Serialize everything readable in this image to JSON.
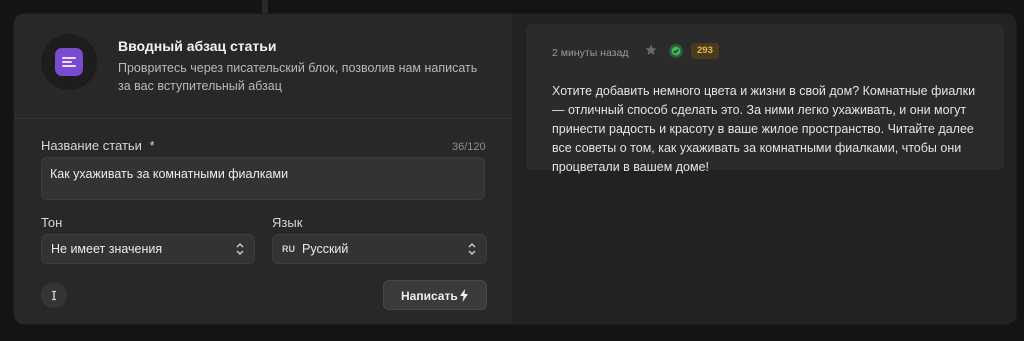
{
  "tool": {
    "title": "Вводный абзац статьи",
    "description": "Провритесь через писательский блок, позволив нам написать за вас вступительный абзац"
  },
  "form": {
    "article_title": {
      "label": "Название статьи",
      "required_mark": "*",
      "counter": "36/120",
      "value": "Как ухаживать за комнатными фиалками"
    },
    "tone": {
      "label": "Тон",
      "selected": "Не имеет значения"
    },
    "language": {
      "label": "Язык",
      "code": "RU",
      "selected": "Русский"
    },
    "info_icon": "info-icon",
    "submit_label": "Написать",
    "submit_icon": "lightning-icon"
  },
  "result": {
    "timestamp": "2 минуты назад",
    "word_count": "293",
    "text": "Хотите добавить немного цвета и жизни в свой дом? Комнатные фиалки — отличный способ сделать это. За ними легко ухаживать, и они могут принести радость и красоту в ваше жилое пространство. Читайте далее все советы о том, как ухаживать за комнатными фиалками, чтобы они процветали в вашем доме!"
  },
  "colors": {
    "accent_purple": "#7a4bd1",
    "badge_text": "#e6b84a",
    "badge_bg": "#4a3b1e",
    "check_green": "#3fb75a"
  }
}
